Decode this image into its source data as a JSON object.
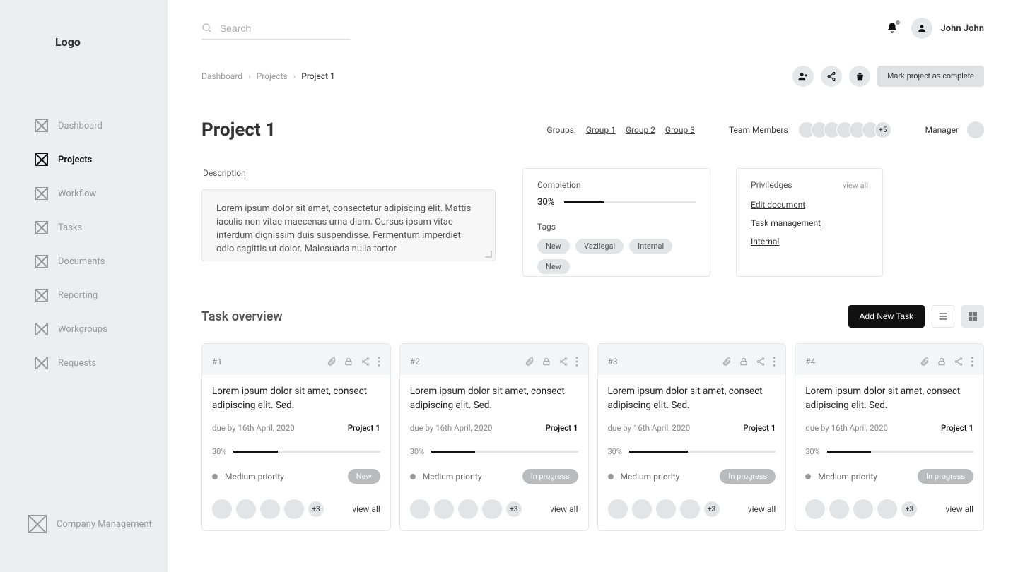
{
  "logo": "Logo",
  "sidebar": {
    "items": [
      {
        "label": "Dashboard",
        "active": false
      },
      {
        "label": "Projects",
        "active": true
      },
      {
        "label": "Workflow",
        "active": false
      },
      {
        "label": "Tasks",
        "active": false
      },
      {
        "label": "Documents",
        "active": false
      },
      {
        "label": "Reporting",
        "active": false
      },
      {
        "label": "Workgroups",
        "active": false
      },
      {
        "label": "Requests",
        "active": false
      }
    ],
    "footer": "Company Management"
  },
  "search": {
    "placeholder": "Search"
  },
  "user": {
    "name": "John John"
  },
  "breadcrumb": {
    "items": [
      "Dashboard",
      "Projects",
      "Project 1"
    ]
  },
  "action_bar": {
    "complete_label": "Mark project as complete"
  },
  "project": {
    "title": "Project 1",
    "groups_label": "Groups:",
    "groups": [
      "Group 1",
      "Group 2",
      "Group 3"
    ],
    "team_label": "Team Members",
    "team_more": "+5",
    "manager_label": "Manager",
    "description_label": "Description",
    "description": "Lorem ipsum dolor sit amet, consectetur adipiscing elit. Mattis iaculis non vitae maecenas urna diam. Cursus ipsum vitae interdum dignissim duis suspendisse. Fermentum imperdiet odio sagittis ut dolor. Malesuada nulla tortor",
    "completion_label": "Completion",
    "completion_text": "30%",
    "completion_pct": 30,
    "tags_label": "Tags",
    "tags": [
      "New",
      "Vazilegal",
      "Internal",
      "New"
    ],
    "privileges_label": "Priviledges",
    "privileges_view_all": "view all",
    "privileges": [
      "Edit document",
      "Task management",
      "Internal"
    ]
  },
  "task_section": {
    "title": "Task overview",
    "add_label": "Add New Task"
  },
  "tasks": [
    {
      "id": "#1",
      "title": "Lorem ipsum dolor sit amet, consect adipiscing elit. Sed.",
      "due": "due by 16th April, 2020",
      "project": "Project 1",
      "pct_text": "30%",
      "pct": 30,
      "priority": "Medium priority",
      "status": "New",
      "more": "+3",
      "view_all": "view all"
    },
    {
      "id": "#2",
      "title": "Lorem ipsum dolor sit amet, consect adipiscing elit. Sed.",
      "due": "due by 16th April, 2020",
      "project": "Project 1",
      "pct_text": "30%",
      "pct": 30,
      "priority": "Medium priority",
      "status": "In progress",
      "more": "+3",
      "view_all": "view all"
    },
    {
      "id": "#3",
      "title": "Lorem ipsum dolor sit amet, consect adipiscing elit. Sed.",
      "due": "due by 16th April, 2020",
      "project": "Project 1",
      "pct_text": "30%",
      "pct": 40,
      "priority": "Medium priority",
      "status": "In progress",
      "more": "+3",
      "view_all": "view all"
    },
    {
      "id": "#4",
      "title": "Lorem ipsum dolor sit amet, consect adipiscing elit. Sed.",
      "due": "due by 16th April, 2020",
      "project": "Project 1",
      "pct_text": "30%",
      "pct": 30,
      "priority": "Medium priority",
      "status": "In progress",
      "more": "+3",
      "view_all": "view all"
    }
  ]
}
